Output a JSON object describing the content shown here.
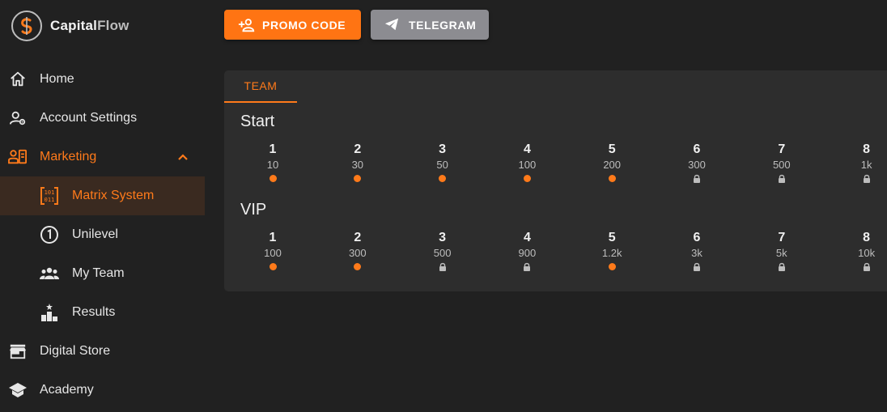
{
  "brand": {
    "name_part1": "Capital",
    "name_part2": "Flow",
    "accent": "#ff7a1a"
  },
  "sidebar": {
    "items": [
      {
        "label": "Home",
        "icon": "home-icon"
      },
      {
        "label": "Account Settings",
        "icon": "user-settings-icon"
      },
      {
        "label": "Marketing",
        "icon": "marketing-icon",
        "expanded": true
      },
      {
        "label": "Matrix System",
        "icon": "matrix-icon",
        "active": true
      },
      {
        "label": "Unilevel",
        "icon": "one-circle-icon"
      },
      {
        "label": "My Team",
        "icon": "group-icon"
      },
      {
        "label": "Results",
        "icon": "podium-icon"
      },
      {
        "label": "Digital Store",
        "icon": "store-icon"
      },
      {
        "label": "Academy",
        "icon": "school-icon"
      }
    ]
  },
  "toolbar": {
    "promo_label": "PROMO CODE",
    "telegram_label": "TELEGRAM"
  },
  "card": {
    "tab_label": "TEAM",
    "sections": [
      {
        "title": "Start",
        "levels": [
          {
            "num": "1",
            "price": "10",
            "status": "active"
          },
          {
            "num": "2",
            "price": "30",
            "status": "active"
          },
          {
            "num": "3",
            "price": "50",
            "status": "active"
          },
          {
            "num": "4",
            "price": "100",
            "status": "active"
          },
          {
            "num": "5",
            "price": "200",
            "status": "active"
          },
          {
            "num": "6",
            "price": "300",
            "status": "locked"
          },
          {
            "num": "7",
            "price": "500",
            "status": "locked"
          },
          {
            "num": "8",
            "price": "1k",
            "status": "locked"
          }
        ]
      },
      {
        "title": "VIP",
        "levels": [
          {
            "num": "1",
            "price": "100",
            "status": "active"
          },
          {
            "num": "2",
            "price": "300",
            "status": "active"
          },
          {
            "num": "3",
            "price": "500",
            "status": "locked"
          },
          {
            "num": "4",
            "price": "900",
            "status": "locked"
          },
          {
            "num": "5",
            "price": "1.2k",
            "status": "active"
          },
          {
            "num": "6",
            "price": "3k",
            "status": "locked"
          },
          {
            "num": "7",
            "price": "5k",
            "status": "locked"
          },
          {
            "num": "8",
            "price": "10k",
            "status": "locked"
          }
        ]
      }
    ]
  }
}
